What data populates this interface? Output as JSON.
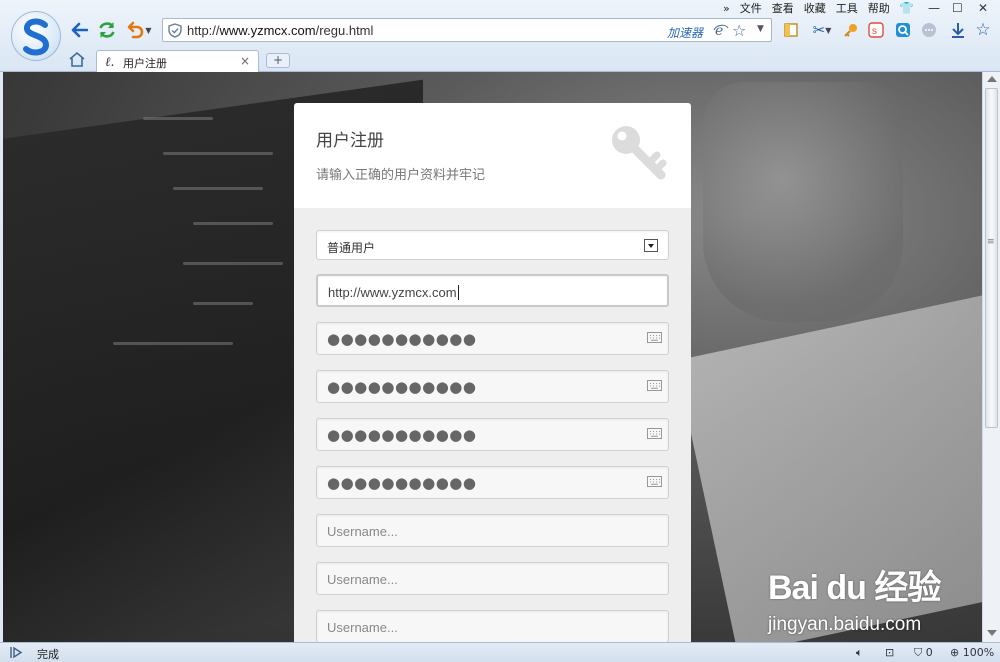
{
  "browser": {
    "address_url_prefix": "http://",
    "address_url_domain": "www.yzmcx.com",
    "address_url_path": "/regu.html",
    "accelerator_label": "加速器",
    "menu": [
      "»",
      "文件",
      "查看",
      "收藏",
      "工具",
      "帮助"
    ],
    "tab_label": "用户注册",
    "tab_close": "×",
    "new_tab": "+"
  },
  "page": {
    "form_title": "用户注册",
    "form_subtitle": "请输入正确的用户资料并牢记",
    "user_type_selected": "普通用户",
    "url_field_value": "http://www.yzmcx.com",
    "password_masks": [
      "●●●●●●●●●●●",
      "●●●●●●●●●●●",
      "●●●●●●●●●●●",
      "●●●●●●●●●●●"
    ],
    "username_placeholders": [
      "Username...",
      "Username...",
      "Username..."
    ]
  },
  "watermark": {
    "brand": "Bai du 经验",
    "site": "jingyan.baidu.com"
  },
  "status": {
    "text": "完成",
    "security_count": "0",
    "zoom": "100%"
  },
  "colors": {
    "chrome_bg": "#dae6f4",
    "accent_blue": "#2a66b6",
    "refresh_green": "#2aa33a",
    "undo_orange": "#e07a10"
  }
}
